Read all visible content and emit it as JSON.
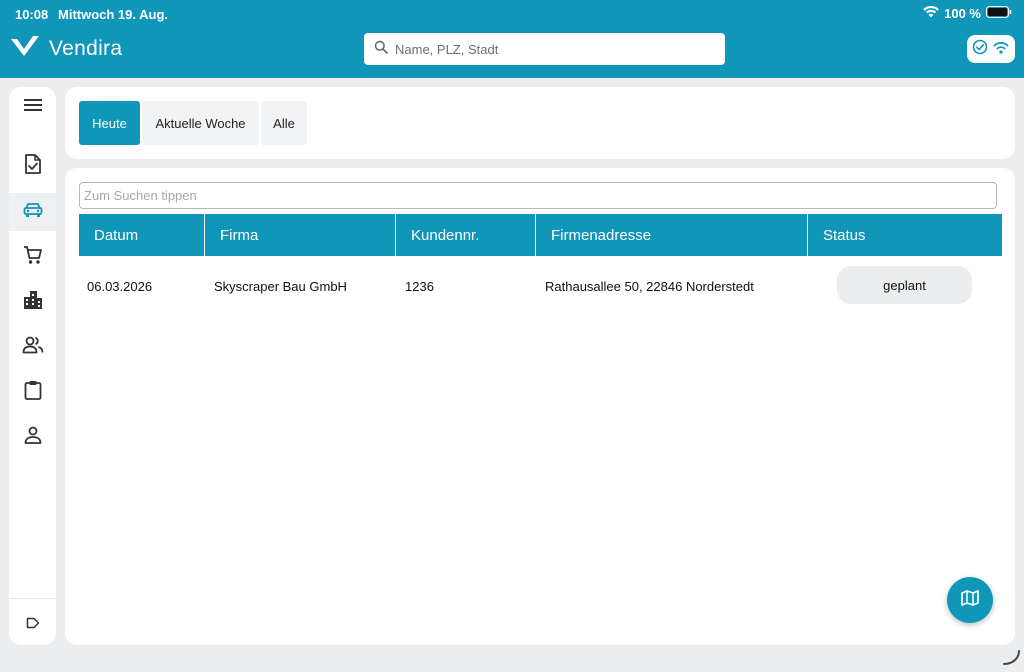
{
  "status_bar": {
    "time": "10:08",
    "date": "Mittwoch 19. Aug.",
    "battery": "100 %"
  },
  "header": {
    "brand": "Vendira",
    "search_placeholder": "Name, PLZ, Stadt"
  },
  "sidebar": {
    "items": [
      {
        "icon": "menu-icon"
      },
      {
        "icon": "document-check-icon"
      },
      {
        "icon": "car-icon",
        "active": true
      },
      {
        "icon": "shopping-cart-icon"
      },
      {
        "icon": "buildings-icon"
      },
      {
        "icon": "people-icon"
      },
      {
        "icon": "clipboard-icon"
      },
      {
        "icon": "person-icon"
      },
      {
        "icon": "label-icon"
      }
    ]
  },
  "filters": {
    "tabs": [
      {
        "label": "Heute",
        "active": true
      },
      {
        "label": "Aktuelle Woche",
        "active": false
      },
      {
        "label": "Alle",
        "active": false
      }
    ]
  },
  "table": {
    "search_placeholder": "Zum Suchen tippen",
    "columns": [
      "Datum",
      "Firma",
      "Kundennr.",
      "Firmenadresse",
      "Status"
    ],
    "rows": [
      {
        "datum": "06.03.2026",
        "firma": "Skyscraper Bau GmbH",
        "kundennr": "1236",
        "adresse": "Rathausallee 50, 22846 Norderstedt",
        "status": "geplant"
      }
    ]
  },
  "colors": {
    "accent": "#0f96b8",
    "background": "#ebedef",
    "card": "#ffffff"
  }
}
